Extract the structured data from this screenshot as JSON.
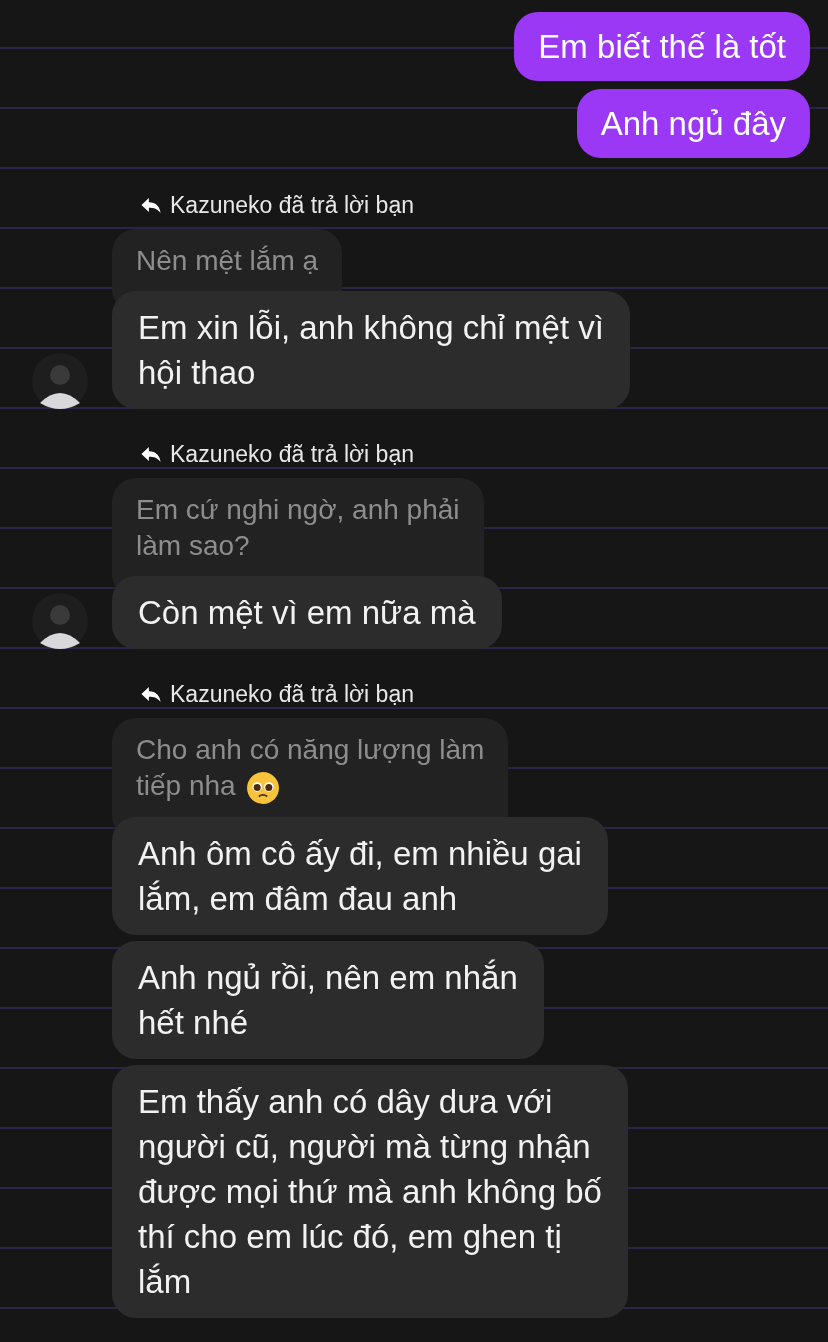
{
  "messages": [
    {
      "kind": "sent",
      "text": "Em biết thế là tốt"
    },
    {
      "kind": "sent",
      "text": "Anh ngủ đây"
    },
    {
      "kind": "reply_note",
      "text": "Kazuneko đã trả lời bạn"
    },
    {
      "kind": "quoted",
      "text": "Nên mệt lắm ạ",
      "emoji": false
    },
    {
      "kind": "received",
      "text": "Em xin lỗi, anh không chỉ mệt vì\nhội thao",
      "avatar": true
    },
    {
      "kind": "reply_note",
      "text": "Kazuneko đã trả lời bạn"
    },
    {
      "kind": "quoted",
      "text": "Em cứ nghi ngờ, anh phải\nlàm sao?",
      "emoji": false
    },
    {
      "kind": "received",
      "text": "Còn mệt vì em nữa mà",
      "avatar": true
    },
    {
      "kind": "reply_note",
      "text": "Kazuneko đã trả lời bạn"
    },
    {
      "kind": "quoted",
      "text": "Cho anh có năng lượng làm\ntiếp nha",
      "emoji": true
    },
    {
      "kind": "received",
      "text": "Anh ôm cô ấy đi, em nhiều gai\nlắm, em đâm đau anh",
      "avatar": false
    },
    {
      "kind": "received",
      "text": "Anh ngủ rồi, nên em nhắn\nhết nhé",
      "avatar": false
    },
    {
      "kind": "received",
      "text": "Em thấy anh có dây dưa với\nngười cũ, người mà từng nhận\nđược mọi thứ mà anh không bố\nthí cho em lúc đó, em ghen tị\nlắm",
      "avatar": false
    }
  ]
}
